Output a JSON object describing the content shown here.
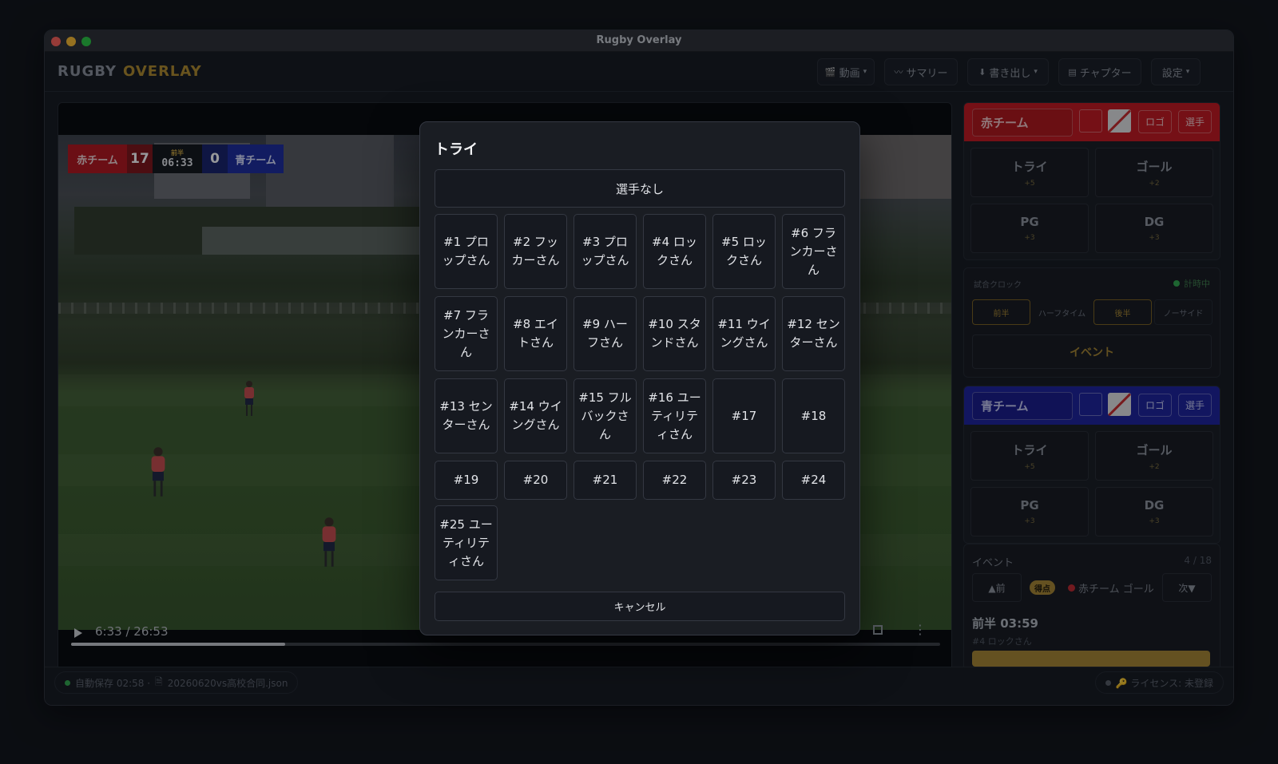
{
  "window": {
    "title": "Rugby Overlay"
  },
  "logo": {
    "part1": "RUGBY",
    "part2": "OVERLAY"
  },
  "menu": [
    {
      "icon": "🎬",
      "label": "動画",
      "caret": "▾"
    },
    {
      "icon": "〰",
      "label": "サマリー",
      "caret": ""
    },
    {
      "icon": "⬇",
      "label": "書き出し",
      "caret": "▾"
    },
    {
      "icon": "▤",
      "label": "チャプター",
      "caret": ""
    },
    {
      "icon": "",
      "label": "設定",
      "caret": "▾"
    }
  ],
  "scorebug": {
    "red_name": "赤チーム",
    "red_score": "17",
    "half": "前半",
    "time": "06:33",
    "blue_score": "0",
    "blue_name": "青チーム"
  },
  "player_controls": {
    "timecode": "6:33 / 26:53",
    "progress": 0.246
  },
  "red_team": {
    "name": "赤チーム",
    "color": "#c4161c",
    "logo_btn": "ロゴ",
    "players_btn": "選手",
    "actions": [
      {
        "label": "トライ",
        "pts": "+5"
      },
      {
        "label": "ゴール",
        "pts": "+2"
      },
      {
        "label": "PG",
        "pts": "+3"
      },
      {
        "label": "DG",
        "pts": "+3"
      }
    ]
  },
  "blue_team": {
    "name": "青チーム",
    "color": "#1a1f9c",
    "logo_btn": "ロゴ",
    "players_btn": "選手",
    "actions": [
      {
        "label": "トライ",
        "pts": "+5"
      },
      {
        "label": "ゴール",
        "pts": "+2"
      },
      {
        "label": "PG",
        "pts": "+3"
      },
      {
        "label": "DG",
        "pts": "+3"
      }
    ]
  },
  "clock": {
    "label": "試合クロック",
    "status": "計時中",
    "periods": [
      "前半",
      "ハーフタイム",
      "後半",
      "ノーサイド"
    ],
    "event_btn": "イベント"
  },
  "events": {
    "title": "イベント",
    "count": "4 / 18",
    "prev": "▲前",
    "next": "次▼",
    "badge": "得点",
    "text": "赤チーム ゴール",
    "time": "前半 03:59",
    "player": "#4 ロックさん"
  },
  "status": {
    "autosave": "自動保存 02:58 · ",
    "file_icon": "🗎",
    "file": "20260620vs高校合同.json",
    "license": "🔑 ライセンス: 未登録"
  },
  "modal": {
    "title": "トライ",
    "no_player": "選手なし",
    "players": [
      "#1 プロップさん",
      "#2 フッカーさん",
      "#3 プロップさん",
      "#4 ロックさん",
      "#5 ロックさん",
      "#6 フランカーさん",
      "#7 フランカーさん",
      "#8 エイトさん",
      "#9 ハーフさん",
      "#10 スタンドさん",
      "#11 ウイングさん",
      "#12 センターさん",
      "#13 センターさん",
      "#14 ウイングさん",
      "#15 フルバックさん",
      "#16 ユーティリティさん",
      "#17",
      "#18",
      "#19",
      "#20",
      "#21",
      "#22",
      "#23",
      "#24",
      "#25 ユーティリティさん"
    ],
    "cancel": "キャンセル"
  }
}
